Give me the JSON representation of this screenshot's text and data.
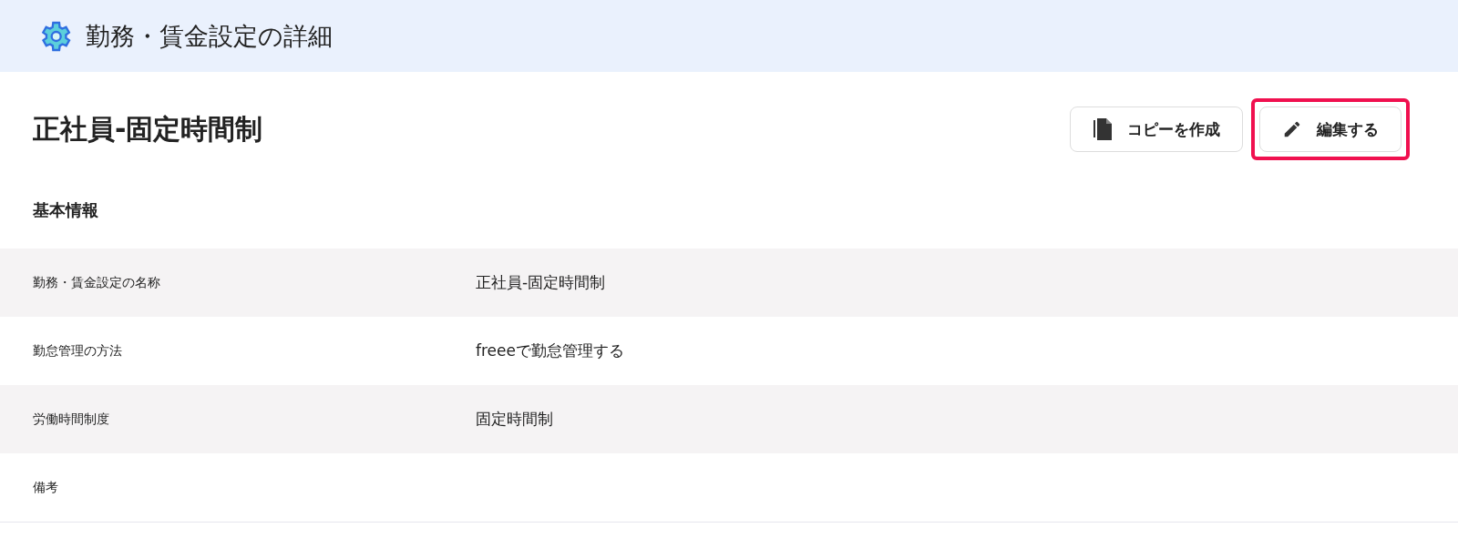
{
  "header": {
    "title": "勤務・賃金設定の詳細"
  },
  "page": {
    "title": "正社員-固定時間制",
    "buttons": [
      {
        "kind": "copy",
        "label": "コピーを作成",
        "highlighted": false
      },
      {
        "kind": "edit",
        "label": "編集する",
        "highlighted": true
      }
    ]
  },
  "section": {
    "title": "基本情報",
    "rows": [
      {
        "label": "勤務・賃金設定の名称",
        "value": "正社員-固定時間制"
      },
      {
        "label": "勤怠管理の方法",
        "value": "freeeで勤怠管理する"
      },
      {
        "label": "労働時間制度",
        "value": "固定時間制"
      },
      {
        "label": "備考"
      }
    ]
  }
}
